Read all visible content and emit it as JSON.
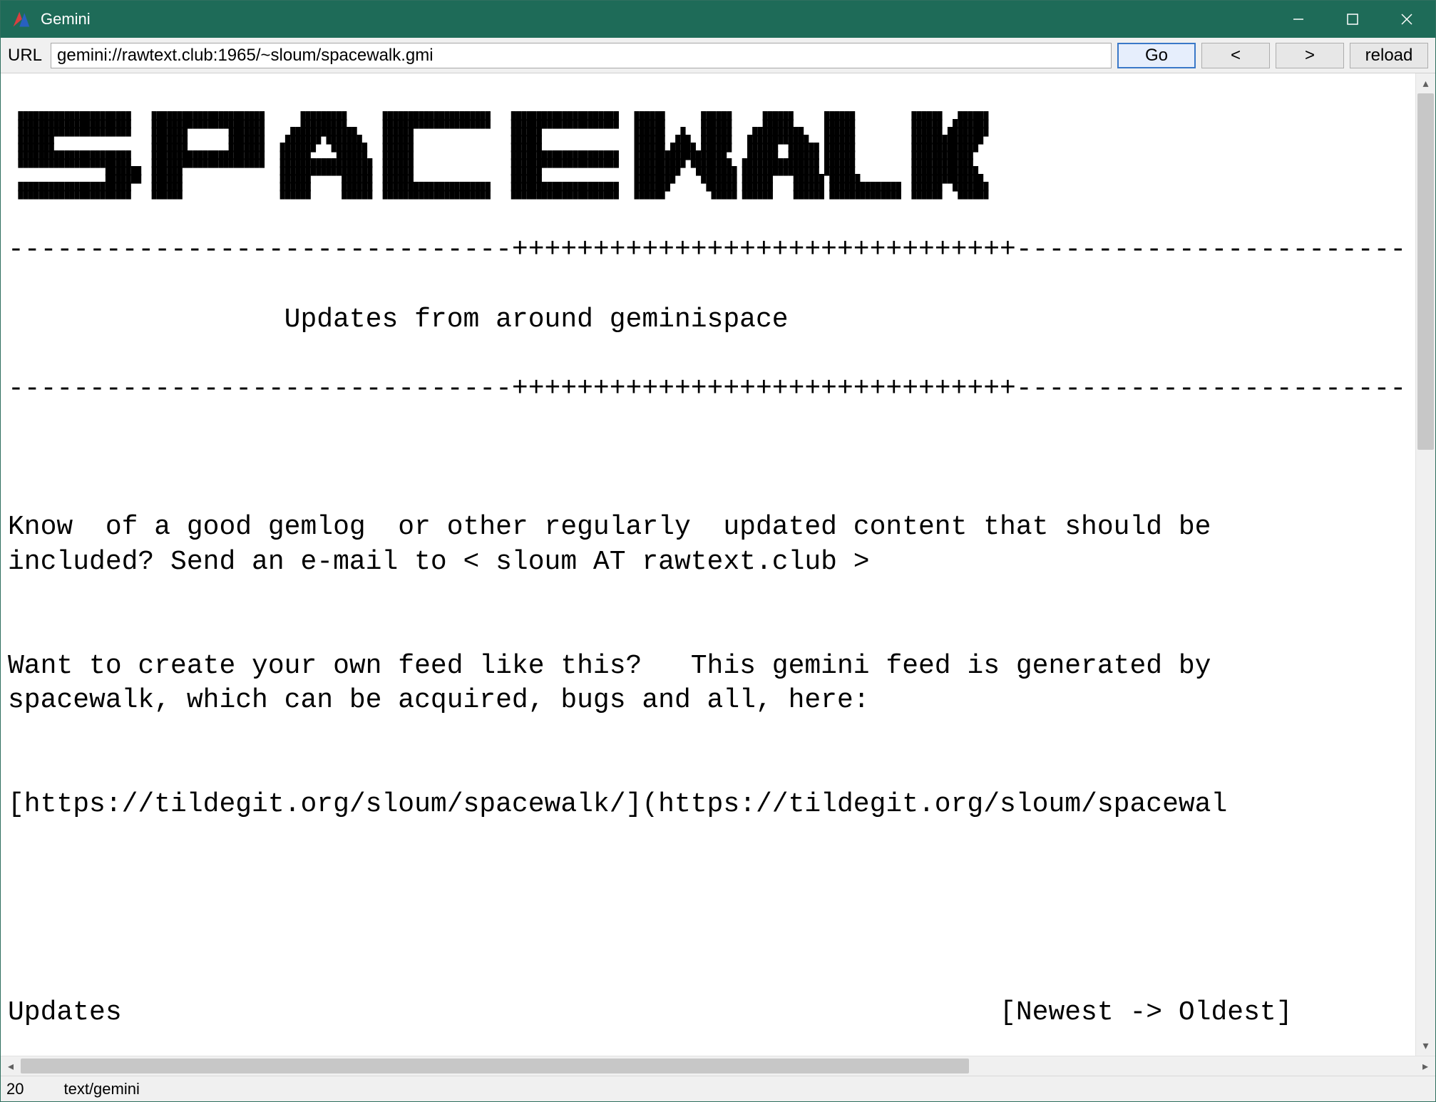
{
  "window": {
    "title": "Gemini"
  },
  "toolbar": {
    "url_label": "URL",
    "url_value": "gemini://rawtext.club:1965/~sloum/spacewalk.gmi",
    "go_label": "Go",
    "back_label": "<",
    "forward_label": ">",
    "reload_label": "reload"
  },
  "page": {
    "divider_top": "-------------------------------+++++++++++++++++++++++++++++++------------------------",
    "subtitle": "                 Updates from around geminispace",
    "divider_bot": "-------------------------------+++++++++++++++++++++++++++++++------------------------",
    "para1": "Know  of a good gemlog  or other regularly  updated content that should be\nincluded? Send an e-mail to < sloum AT rawtext.club >",
    "para2": "Want to create your own feed like this?   This gemini feed is generated by\nspacewalk, which can be acquired, bugs and all, here:",
    "link_line": "[https://tildegit.org/sloum/spacewalk/](https://tildegit.org/sloum/spacewal",
    "updates_heading": "Updates                                                      [Newest -> Oldest]"
  },
  "status": {
    "code": "20",
    "mime": "text/gemini"
  },
  "ascii_banner": "  ██████████████████████    ██████████████████████       █████████       █████████████████████    █████████████████████   ██████       ██████      ██████      ██████           ██████   ██████\n  ██████████████████████    ██████████████████████       █████████       █████████████████████    █████████████████████   ██████       ██████      ██████      ██████           ██████  ███████\n  ██████████████████████    ███████        ███████     █████████████     ██████                   ██████                  ██████   █   ██████    ██████████    ██████           ██████ ████████\n  ███████                   ███████        ███████    ███████ ███████    ██████                   ██████                  ██████  ███  ██████   ████████████   ██████           ██████████████ \n  ███████                   ███████        ███████   ███████   ███████   ██████                   ██████                  ██████ █████ ██████   ██████  ██████ ██████           █████████████  \n  ██████████████████████    ██████████████████████   ██████     ██████   ██████                   █████████████████████   ██████████████████    ██████  ██████ ██████           ████████████   \n  ██████████████████████    ██████████████████████   ██████████████████  ██████                   █████████████████████   ██████████ ████████  ███████████████ ██████           ████████████   \n                   ███████  ██████                   ██████████████████  ██████                   ██████                  █████████   ████████ ███████████████ ██████           █████████████  \n                   ███████  ██████                   ██████      ██████  ██████                   ██████                  ████████     ███████ ██████    ██████ ██████          ██████████████ \n  ██████████████████████    ██████                   ██████      ██████  █████████████████████    █████████████████████   ███████       ██████ ██████    ██████ ██████████████  ██████  ███████\n  ██████████████████████    ██████                   ██████      ██████  █████████████████████    █████████████████████   ██████         █████ ██████    ██████ ██████████████  ██████   ██████"
}
